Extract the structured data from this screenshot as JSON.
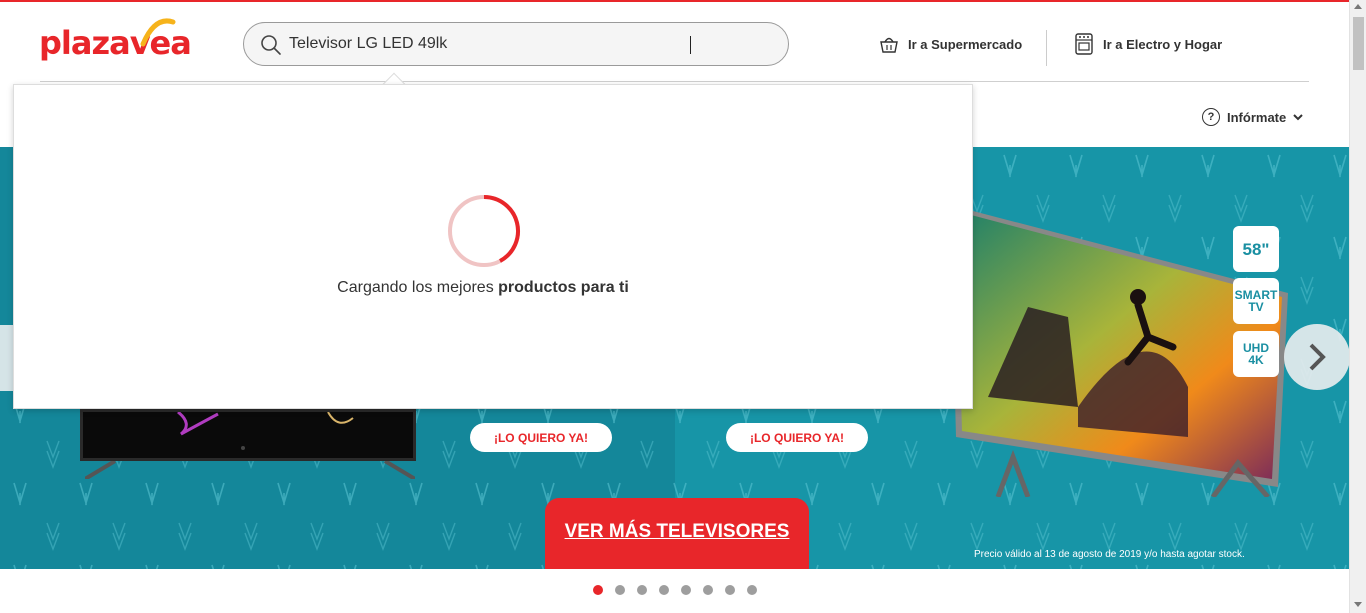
{
  "brand": {
    "logo_text": "plazavea",
    "accent_color": "#e8262a",
    "teal_color": "#1795a7"
  },
  "search": {
    "value": "Televisor LG LED 49lk",
    "icon": "search-icon"
  },
  "header": {
    "supermercado_label": "Ir a Supermercado",
    "electro_label": "Ir a Electro y Hogar",
    "informate_label": "Infórmate",
    "informate_icon": "?"
  },
  "dropdown": {
    "loading_prefix": "Cargando los mejores ",
    "loading_bold": "productos para ti"
  },
  "banner": {
    "cta_left": "¡LO QUIERO YA!",
    "cta_right": "¡LO QUIERO YA!",
    "cta_main": "VER MÁS TELEVISORES",
    "badge_size": "58\"",
    "badge_smart_1": "SMART",
    "badge_smart_2": "TV",
    "badge_uhd_1": "UHD",
    "badge_uhd_2": "4K",
    "disclaimer": "Precio válido al 13 de agosto de 2019 y/o hasta agotar stock."
  },
  "carousel": {
    "slide_count": 8,
    "active_index": 0
  }
}
